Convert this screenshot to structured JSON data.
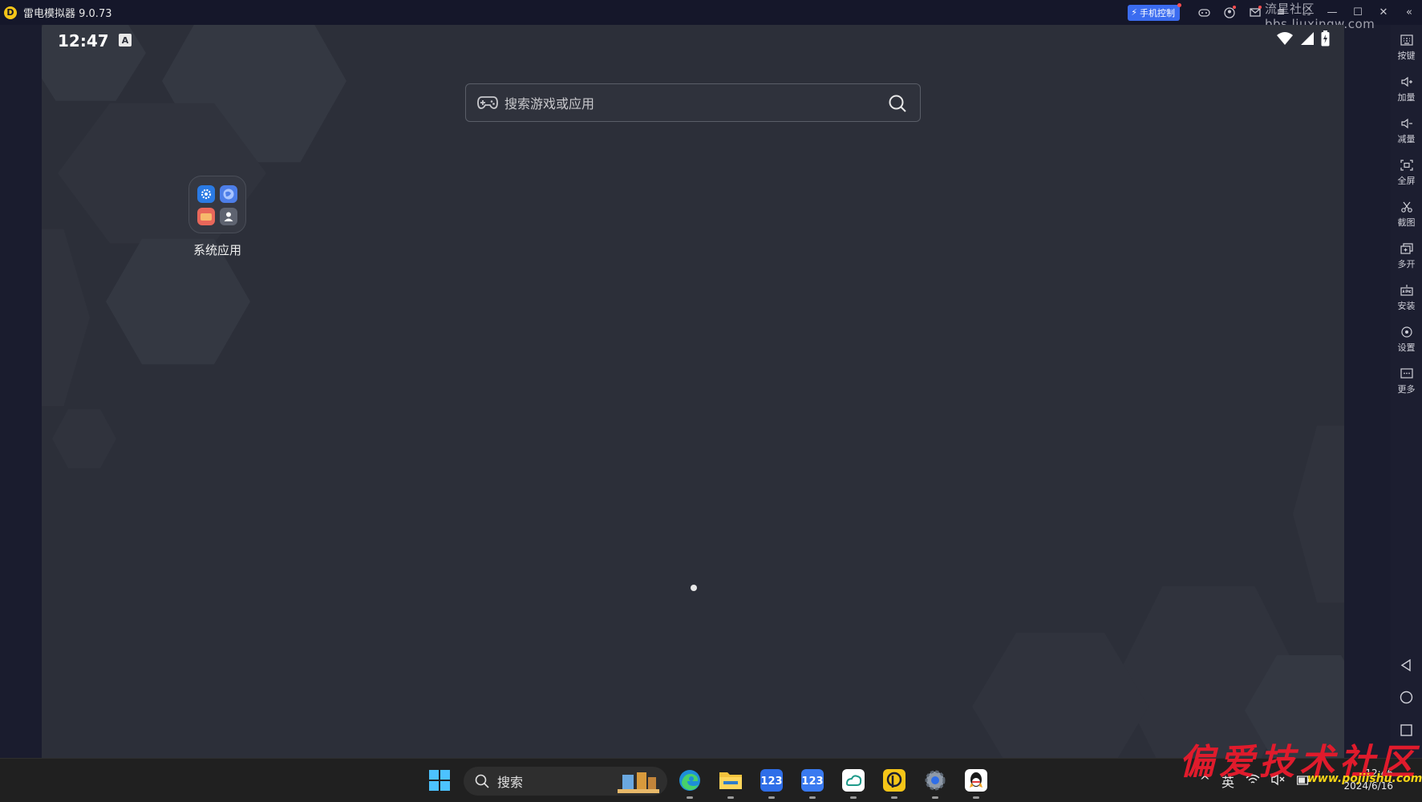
{
  "window": {
    "title": "雷电模拟器 9.0.73",
    "phone_control_label": "手机控制",
    "watermark": "流星社区 bbs.liuxingw.com"
  },
  "android": {
    "status": {
      "time": "12:47",
      "badge": "A"
    },
    "search": {
      "placeholder": "搜索游戏或应用"
    },
    "folder": {
      "label": "系统应用",
      "apps": [
        "settings-icon",
        "browser-icon",
        "gallery-icon",
        "contacts-icon"
      ]
    }
  },
  "sidebar": {
    "buttons": [
      {
        "label": "按键",
        "icon": "keyboard-icon"
      },
      {
        "label": "加量",
        "icon": "volume-up-icon"
      },
      {
        "label": "减量",
        "icon": "volume-down-icon"
      },
      {
        "label": "全屏",
        "icon": "fullscreen-icon"
      },
      {
        "label": "截图",
        "icon": "scissors-icon"
      },
      {
        "label": "多开",
        "icon": "multi-instance-icon"
      },
      {
        "label": "安装",
        "icon": "apk-icon"
      },
      {
        "label": "设置",
        "icon": "settings-icon"
      },
      {
        "label": "更多",
        "icon": "more-icon"
      }
    ]
  },
  "taskbar": {
    "search_label": "搜索",
    "tray_lang": "英",
    "clock_time": "12:46",
    "clock_date": "2024/6/16",
    "apps": [
      "start-icon",
      "edge-icon",
      "file-explorer-icon",
      "123pan-icon",
      "123pan-icon",
      "cloud-app-icon",
      "ldplayer-icon",
      "settings-icon",
      "qq-icon"
    ]
  },
  "branding": {
    "watermark_brand": "偏爱技术社区",
    "watermark_url": "www.pojiishu.com"
  },
  "colors": {
    "accent": "#3b6cf0",
    "screen_bg": "#2c2f39",
    "brand_red": "#e01b2c"
  }
}
